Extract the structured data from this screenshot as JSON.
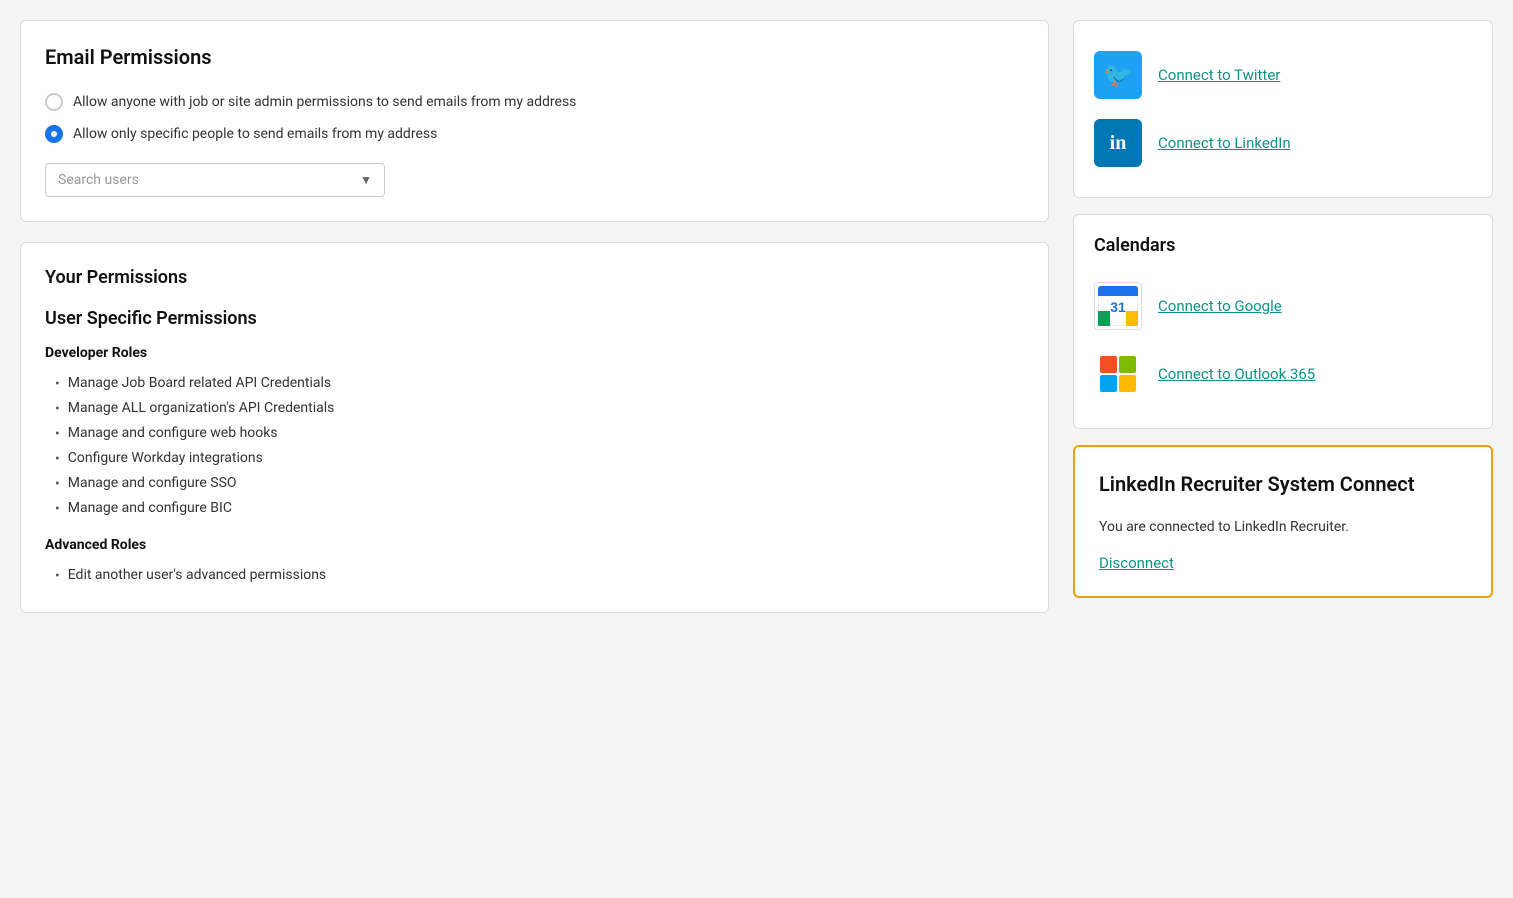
{
  "emailPermissions": {
    "title": "Email Permissions",
    "radioOptions": [
      {
        "id": "option1",
        "label": "Allow anyone with job or site admin permissions to send emails from my address",
        "selected": false
      },
      {
        "id": "option2",
        "label": "Allow only specific people to send emails from my address",
        "selected": true
      }
    ],
    "searchPlaceholder": "Search users"
  },
  "yourPermissions": {
    "title": "Your Permissions",
    "sectionTitle": "User Specific Permissions",
    "developerRoles": {
      "heading": "Developer Roles",
      "items": [
        "Manage Job Board related API Credentials",
        "Manage ALL organization's API Credentials",
        "Manage and configure web hooks",
        "Configure Workday integrations",
        "Manage and configure SSO",
        "Manage and configure BIC"
      ]
    },
    "advancedRoles": {
      "heading": "Advanced Roles",
      "items": [
        "Edit another user's advanced permissions"
      ]
    }
  },
  "socialConnections": {
    "twitter": {
      "linkText": "Connect to Twitter"
    },
    "linkedin": {
      "linkText": "Connect to LinkedIn"
    }
  },
  "calendars": {
    "title": "Calendars",
    "google": {
      "linkText": "Connect to Google"
    },
    "outlook": {
      "linkText": "Connect to Outlook 365"
    }
  },
  "linkedinRecruiter": {
    "title": "LinkedIn Recruiter System Connect",
    "description": "You are connected to LinkedIn Recruiter.",
    "disconnectLabel": "Disconnect"
  }
}
